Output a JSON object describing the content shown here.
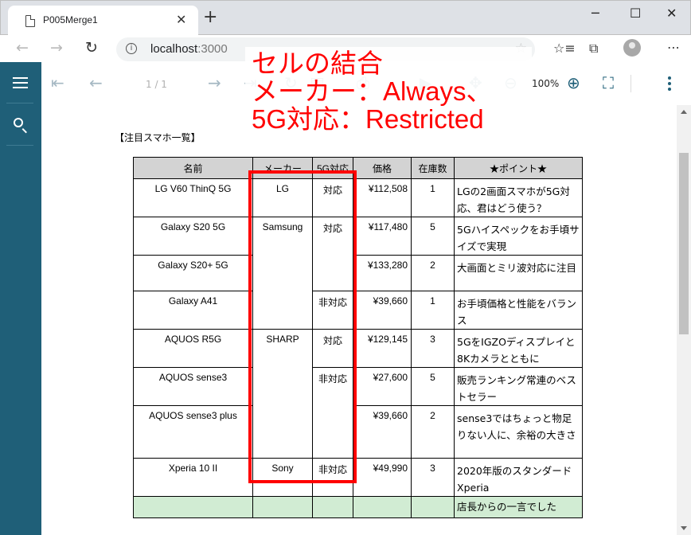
{
  "browser": {
    "tab_title": "P005Merge1",
    "url_host": "localhost",
    "url_port": ":3000"
  },
  "viewer": {
    "page_info": "1 / 1",
    "zoom": "100%"
  },
  "annotation": "セルの結合\nメーカー：Always、\n5G対応：Restricted",
  "report": {
    "title": "【注目スマホ一覧】",
    "headers": [
      "名前",
      "メーカー",
      "5G対応",
      "価格",
      "在庫数",
      "★ポイント★"
    ],
    "rows": [
      {
        "name": "LG V60 ThinQ 5G",
        "price": "¥112,508",
        "stock": "1",
        "point": "LGの2画面スマホが5G対応、君はどう使う？"
      },
      {
        "name": "Galaxy S20 5G",
        "price": "¥117,480",
        "stock": "5",
        "point": "5Gハイスペックをお手頃サイズで実現"
      },
      {
        "name": "Galaxy S20+ 5G",
        "price": "¥133,280",
        "stock": "2",
        "point": "大画面とミリ波対応に注目"
      },
      {
        "name": "Galaxy A41",
        "price": "¥39,660",
        "stock": "1",
        "point": "お手頃価格と性能をバランス"
      },
      {
        "name": "AQUOS R5G",
        "price": "¥129,145",
        "stock": "3",
        "point": "5GをIGZOディスプレイと8Kカメラとともに"
      },
      {
        "name": "AQUOS sense3",
        "price": "¥27,600",
        "stock": "5",
        "point": "販売ランキング常連のベストセラー"
      },
      {
        "name": "AQUOS sense3 plus",
        "price": "¥39,660",
        "stock": "2",
        "point": "sense3ではちょっと物足りない人に、余裕の大きさ"
      },
      {
        "name": "Xperia 10 II",
        "price": "¥49,990",
        "stock": "3",
        "point": "2020年版のスタンダードXperia"
      }
    ],
    "makers": [
      "LG",
      "Samsung",
      "SHARP",
      "Sony"
    ],
    "support": [
      "対応",
      "対応",
      "非対応",
      "対応",
      "非対応",
      "非対応"
    ],
    "footer_note": "店長からの一言でした"
  }
}
